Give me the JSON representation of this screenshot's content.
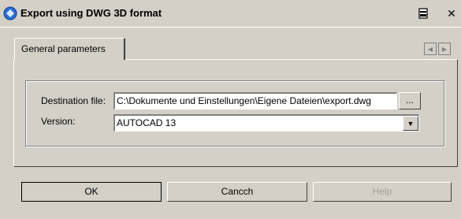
{
  "window": {
    "title": "Export using DWG 3D format",
    "icons": [
      "app-icon",
      "window-menu-icon",
      "close-icon"
    ],
    "close_glyph": "✕"
  },
  "tabs": [
    {
      "label": "General parameters",
      "selected": true
    }
  ],
  "tab_scroll": {
    "left_glyph": "◀",
    "right_glyph": "▶"
  },
  "form": {
    "destination_label": "Destination file:",
    "destination_value": "C:\\Dokumente und Einstellungen\\Eigene Dateien\\export.dwg",
    "browse_label": "...",
    "version_label": "Version:",
    "version_value": "AUTOCAD 13",
    "dropdown_glyph": "▼"
  },
  "buttons": {
    "ok_label": "OK",
    "cancel_label": "Cancch",
    "help_label": "Help"
  },
  "colors": {
    "background": "#d4d0c8",
    "title_icon": "#2a6fd6"
  }
}
